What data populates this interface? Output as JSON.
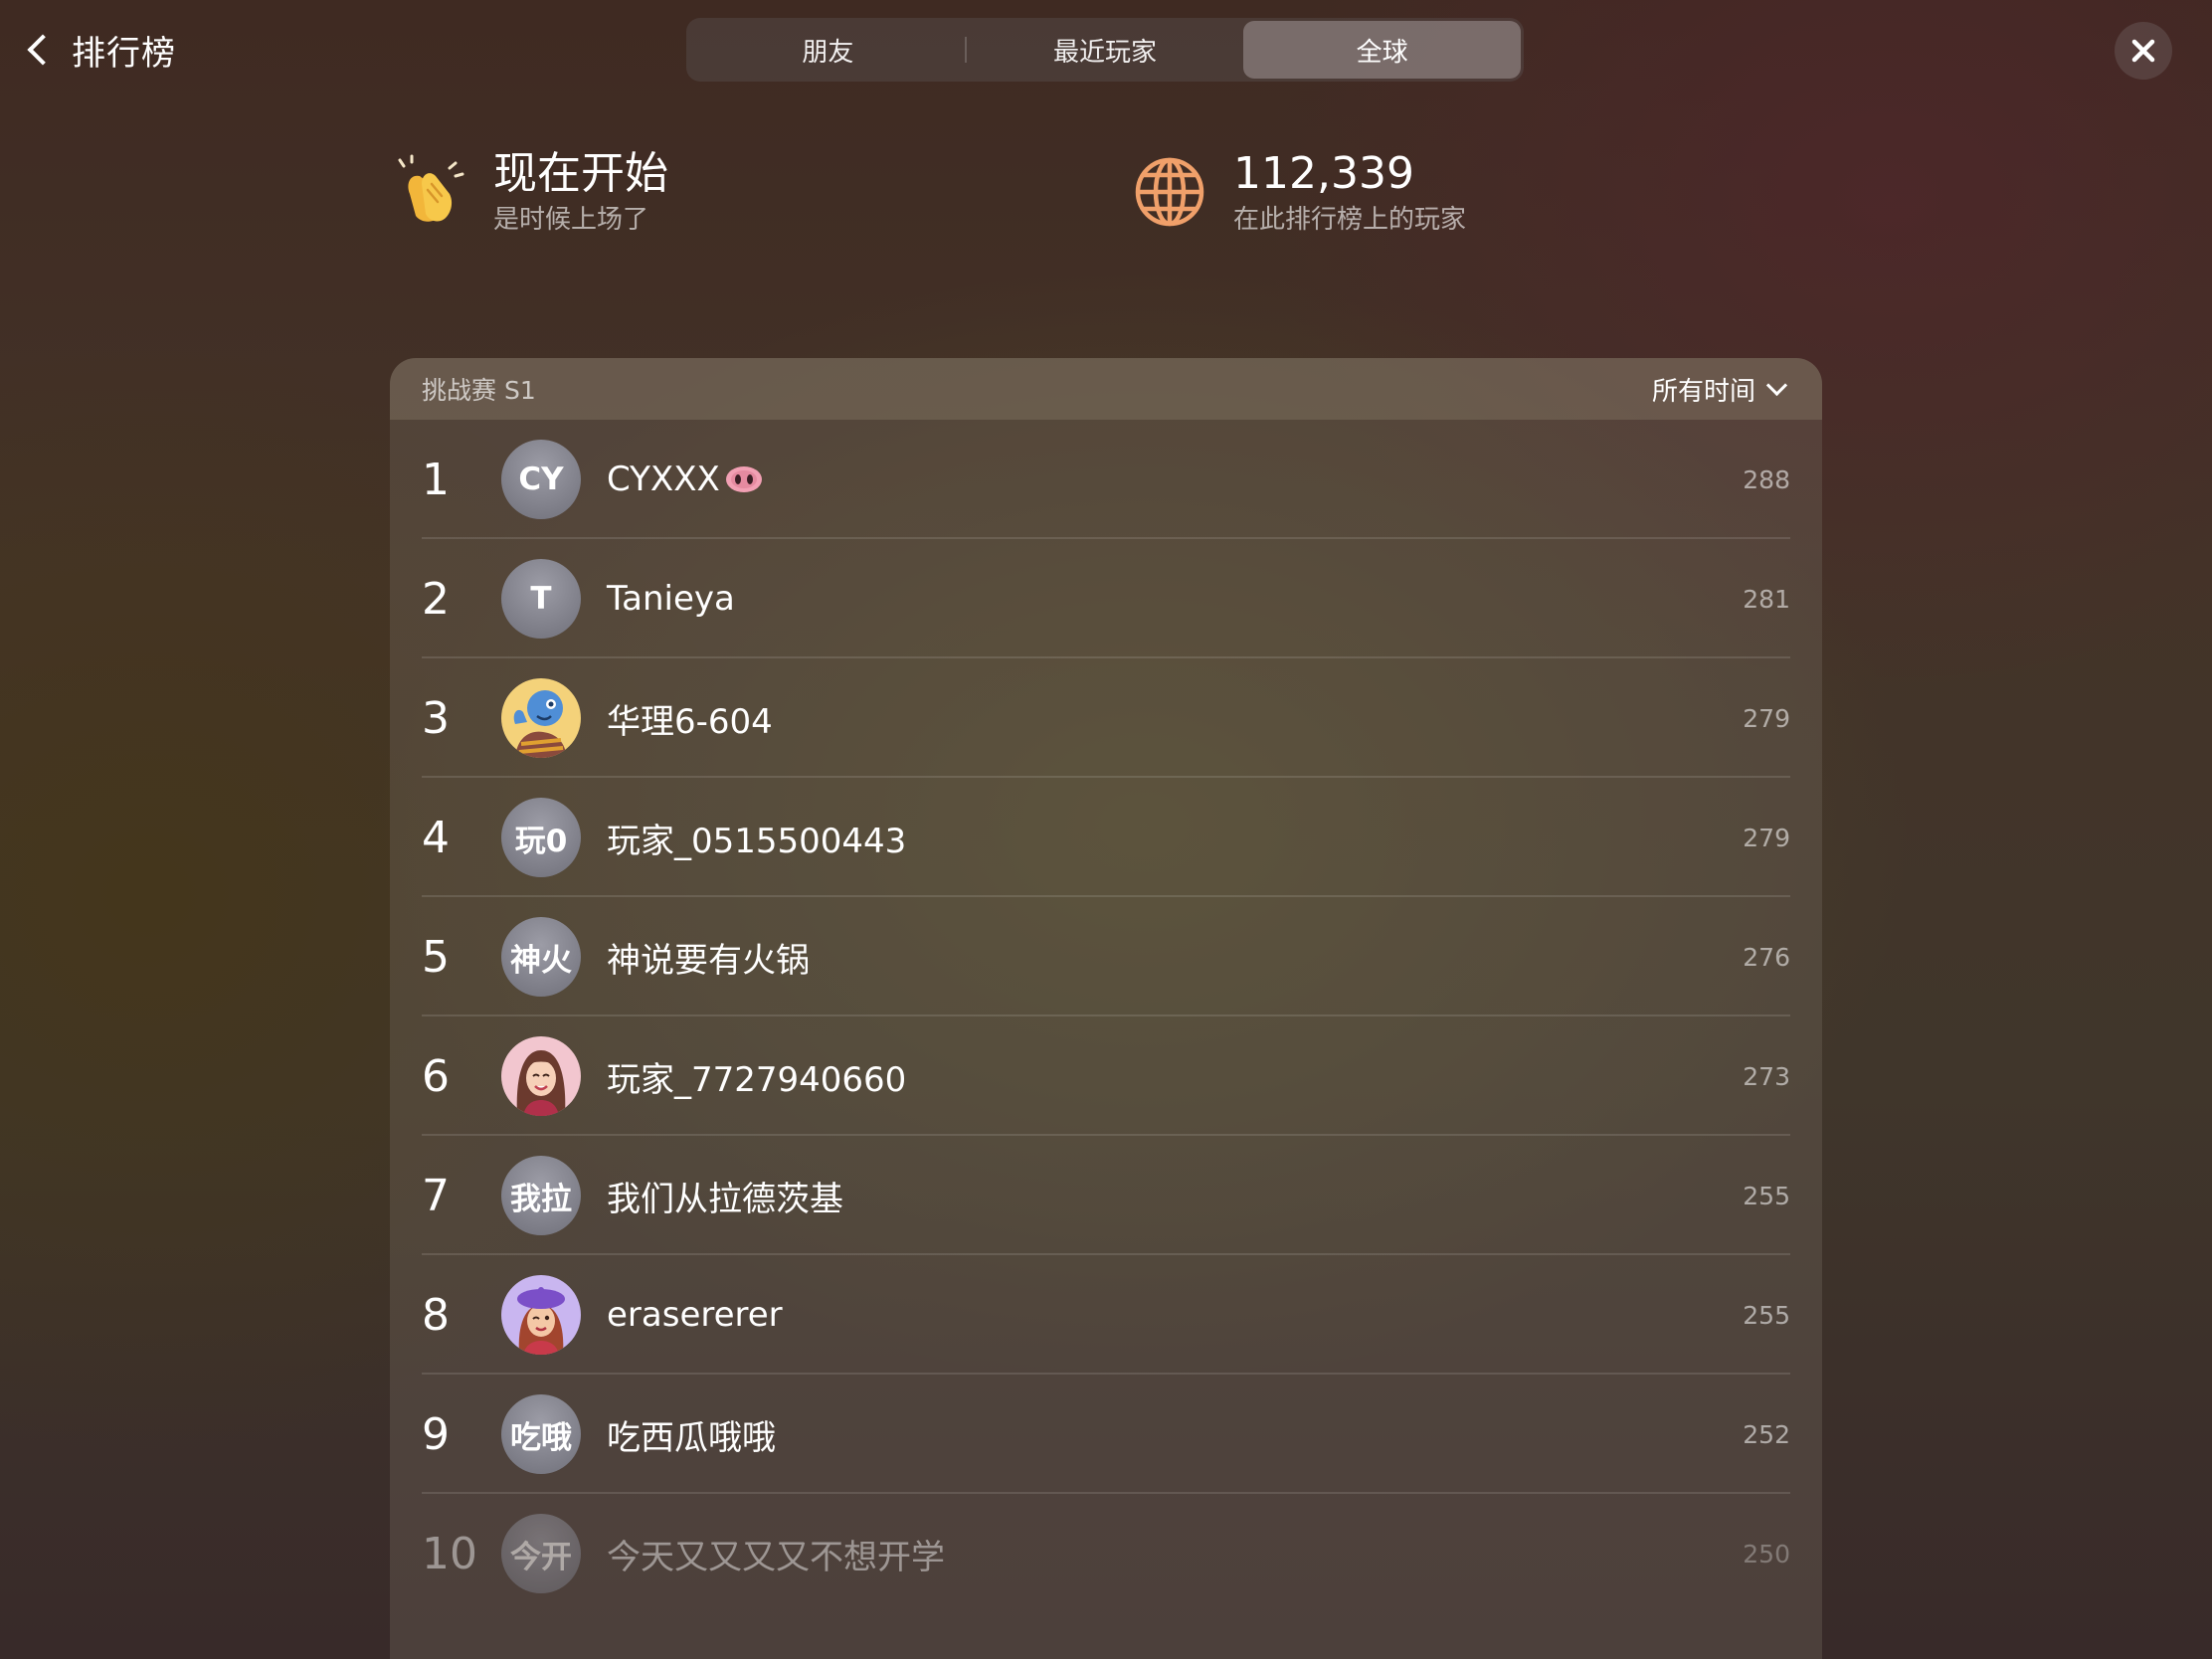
{
  "nav": {
    "back_label": "排行榜",
    "tabs": [
      {
        "label": "朋友",
        "active": false
      },
      {
        "label": "最近玩家",
        "active": false
      },
      {
        "label": "全球",
        "active": true
      }
    ]
  },
  "stats": {
    "left": {
      "icon": "clapping-hands-icon",
      "title": "现在开始",
      "subtitle": "是时候上场了"
    },
    "right": {
      "icon": "globe-icon",
      "title": "112,339",
      "subtitle": "在此排行榜上的玩家"
    }
  },
  "board": {
    "title": "挑战赛 S1",
    "filter_label": "所有时间",
    "rows": [
      {
        "rank": "1",
        "avatar": "CY",
        "name": "CYXXX",
        "badge": "pig-nose-emoji",
        "score": "288"
      },
      {
        "rank": "2",
        "avatar": "T",
        "name": "Tanieya",
        "score": "281"
      },
      {
        "rank": "3",
        "avatar": "memoji-blue-face",
        "name": "华理6-604",
        "score": "279"
      },
      {
        "rank": "4",
        "avatar": "玩0",
        "name": "玩家_0515500443",
        "score": "279"
      },
      {
        "rank": "5",
        "avatar": "神火",
        "name": "神说要有火锅",
        "score": "276"
      },
      {
        "rank": "6",
        "avatar": "memoji-girl",
        "name": "玩家_7727940660",
        "score": "273"
      },
      {
        "rank": "7",
        "avatar": "我拉",
        "name": "我们从拉德茨基",
        "score": "255"
      },
      {
        "rank": "8",
        "avatar": "memoji-beret",
        "name": "erasererer",
        "score": "255"
      },
      {
        "rank": "9",
        "avatar": "吃哦",
        "name": "吃西瓜哦哦",
        "score": "252"
      },
      {
        "rank": "10",
        "avatar": "今开",
        "name": "今天又又又又不想开学",
        "score": "250"
      }
    ]
  },
  "colors": {
    "accent_globe": "#f0a06a",
    "avatar_gray": "#85858f"
  }
}
